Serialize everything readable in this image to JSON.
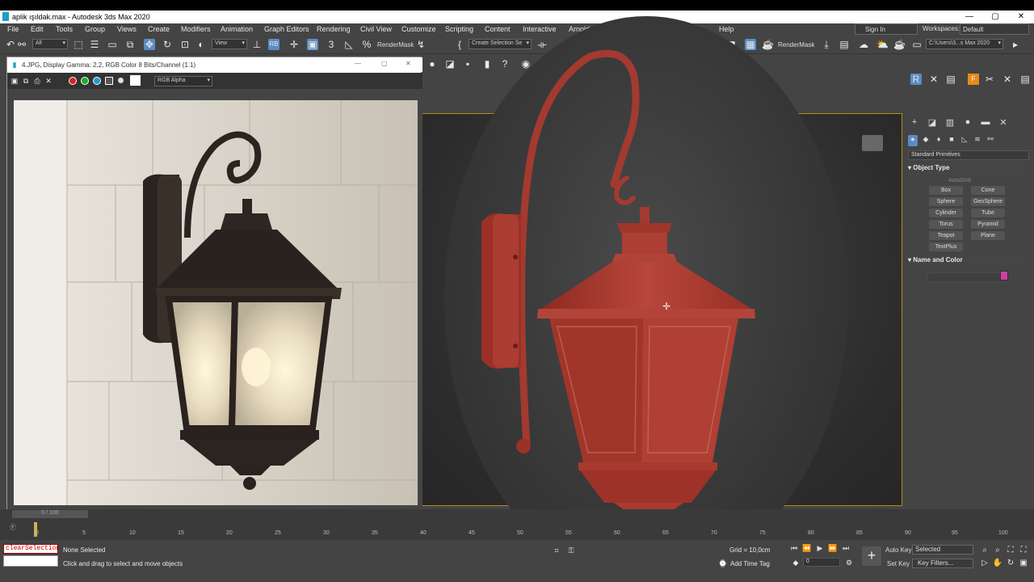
{
  "window": {
    "title": "aplik ışıldak.max - Autodesk 3ds Max 2020",
    "min": "—",
    "max": "▢",
    "close": "✕"
  },
  "menu": [
    "File",
    "Edit",
    "Tools",
    "Group",
    "Views",
    "Create",
    "Modifiers",
    "Animation",
    "Graph Editors",
    "Rendering",
    "Civil View",
    "Customize",
    "Scripting",
    "Content",
    "Interactive",
    "Arnold",
    "Help"
  ],
  "signin": "Sign In",
  "workspace": {
    "label": "Workspaces:",
    "value": "Default"
  },
  "toolbar": {
    "filter": "All",
    "view": "View",
    "rendermask": "RenderMask",
    "selset": "Create Selection Se",
    "path": "C:\\Users\\3...s Max 2020"
  },
  "picture_window": {
    "title": "4.JPG, Display Gamma: 2,2, RGB Color 8 Bits/Channel (1:1)",
    "channel": "RGB Alpha",
    "min": "—",
    "max": "▢",
    "close": "✕"
  },
  "right_panel": {
    "dropdown": "Standard Primitives",
    "section_object": "Object Type",
    "autogrid": "AutoGrid",
    "buttons": [
      "Box",
      "Cone",
      "Sphere",
      "GeoSphere",
      "Cylinder",
      "Tube",
      "Torus",
      "Pyramid",
      "Teapot",
      "Plane",
      "TextPlus"
    ],
    "section_name": "Name and Color",
    "color": "#d23ea0"
  },
  "timeline": {
    "range": "0 / 100",
    "ticks": [
      "0",
      "5",
      "10",
      "15",
      "20",
      "25",
      "30",
      "35",
      "40",
      "45",
      "50",
      "55",
      "60",
      "65",
      "70",
      "75",
      "80",
      "85",
      "90",
      "95",
      "100"
    ]
  },
  "status": {
    "maxscript": "clearSelection",
    "selected": "None Selected",
    "hint": "Click and drag to select and move objects",
    "grid": "Grid = 10,0cm",
    "addtag": "Add Time Tag",
    "frame": "0",
    "autokey": "Auto Key",
    "setkey": "Set Key",
    "selected_dd": "Selected",
    "keyfilters": "Key Filters..."
  }
}
